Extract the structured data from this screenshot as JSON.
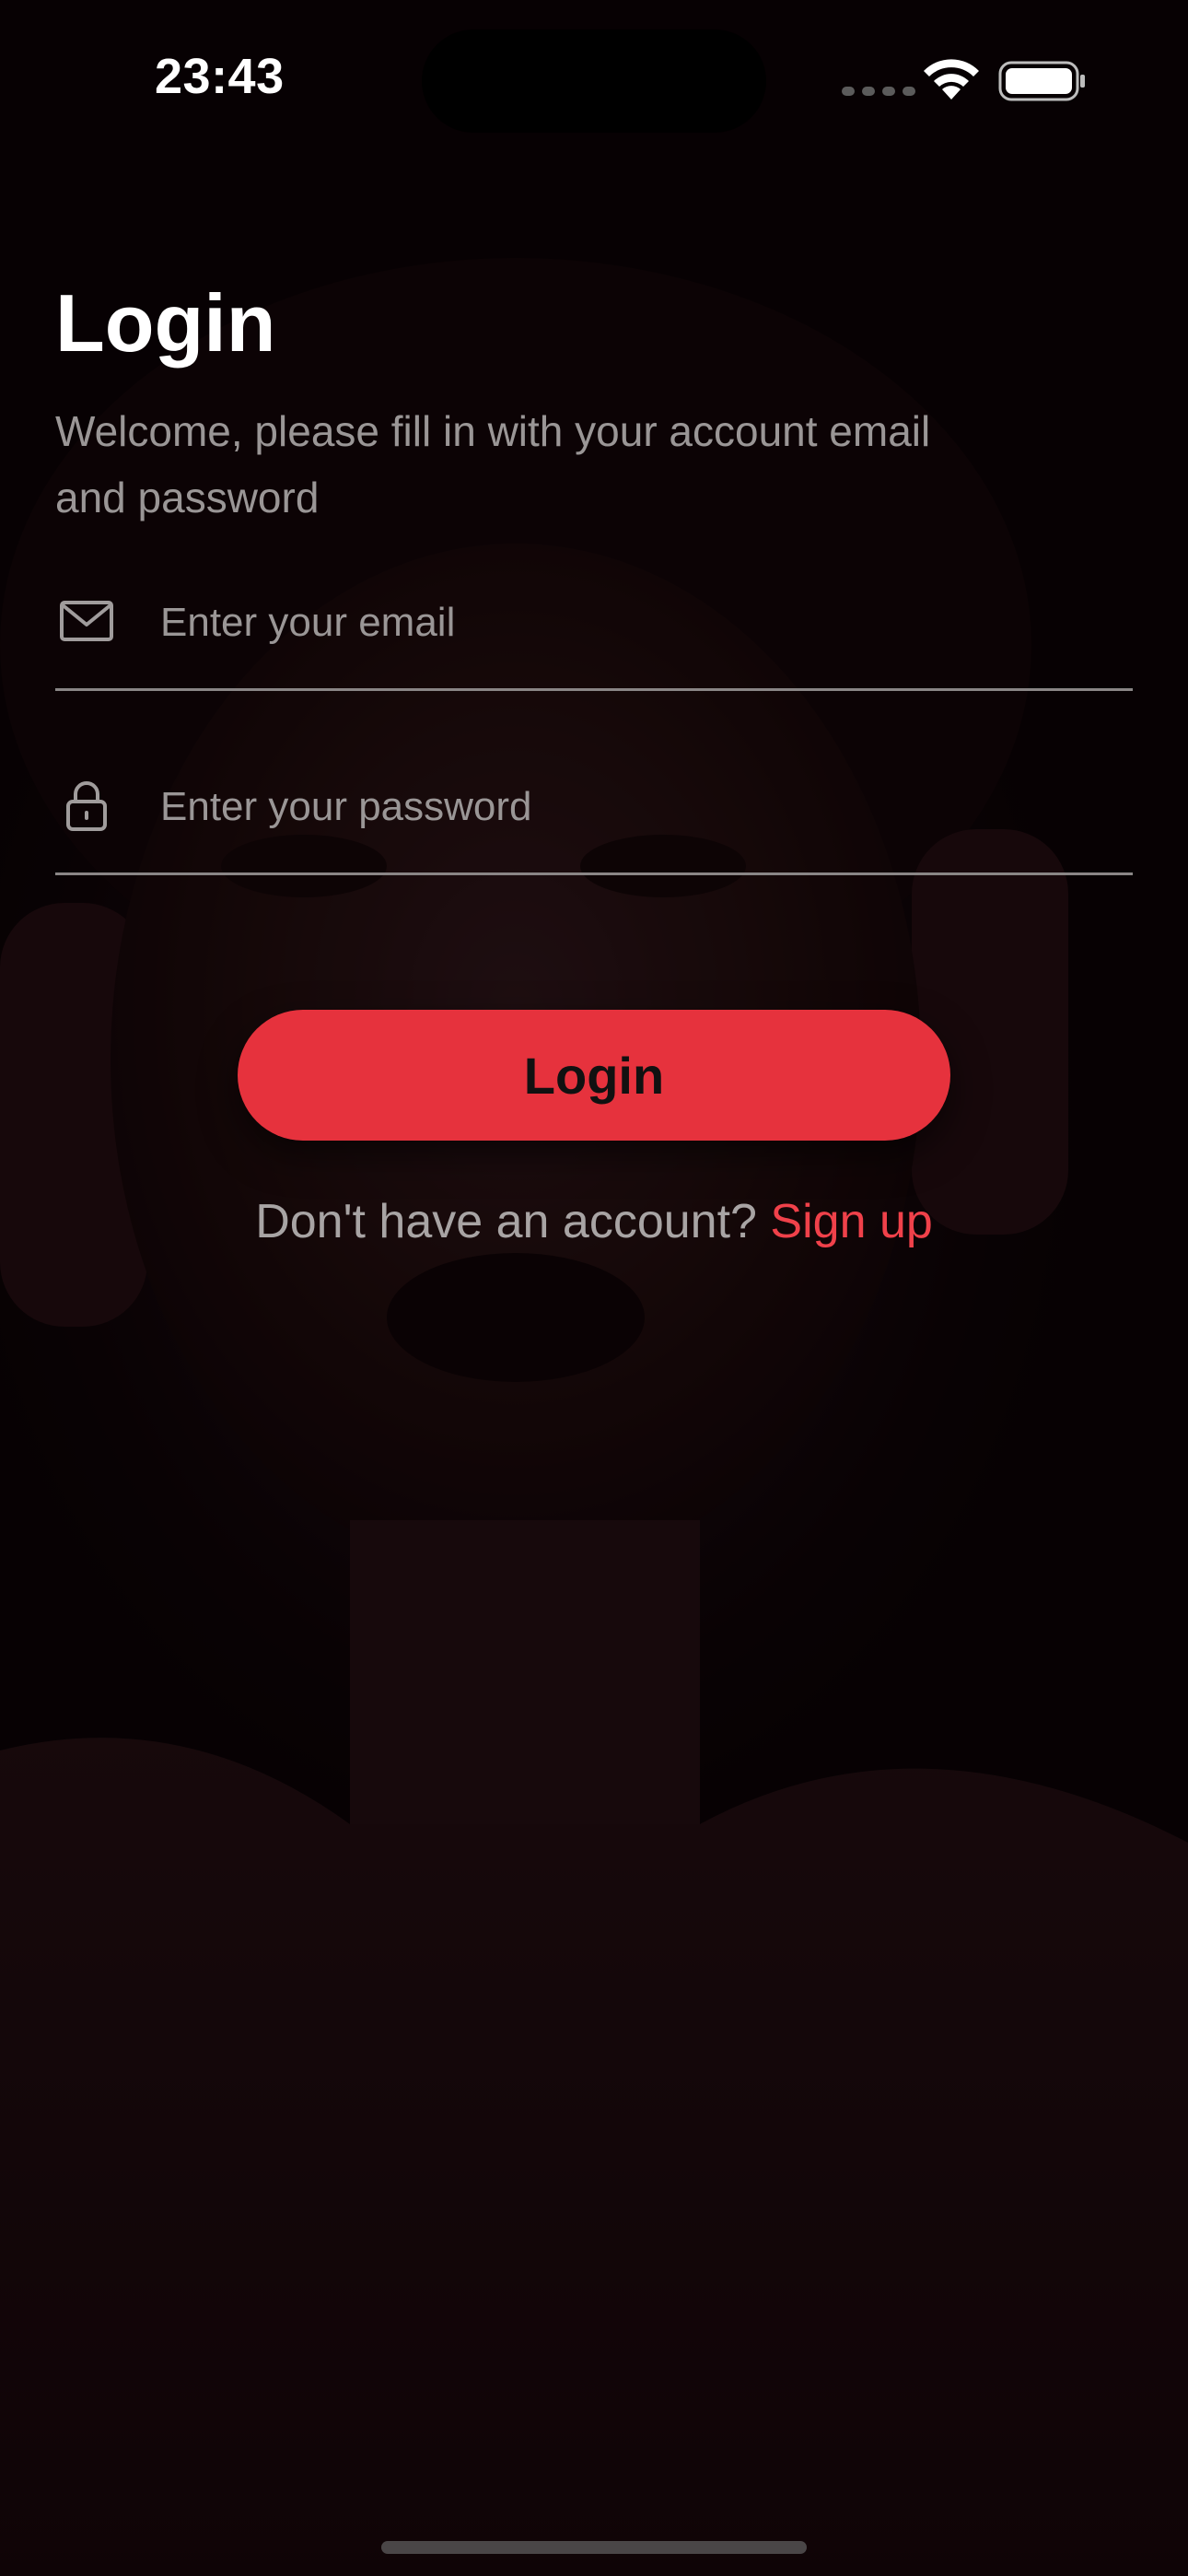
{
  "status_bar": {
    "time": "23:43"
  },
  "screen": {
    "title": "Login",
    "subtitle": "Welcome, please fill in with your account email and password"
  },
  "email_field": {
    "icon": "envelope-icon",
    "placeholder": "Enter your email",
    "value": ""
  },
  "password_field": {
    "icon": "lock-icon",
    "placeholder": "Enter your password",
    "value": ""
  },
  "login_button": {
    "label": "Login"
  },
  "signup": {
    "prompt": "Don't have an account?",
    "link_label": "Sign up"
  },
  "colors": {
    "accent": "#e6323d",
    "link": "#f0414a",
    "background": "#0d0406",
    "muted_text": "#9a9696"
  }
}
